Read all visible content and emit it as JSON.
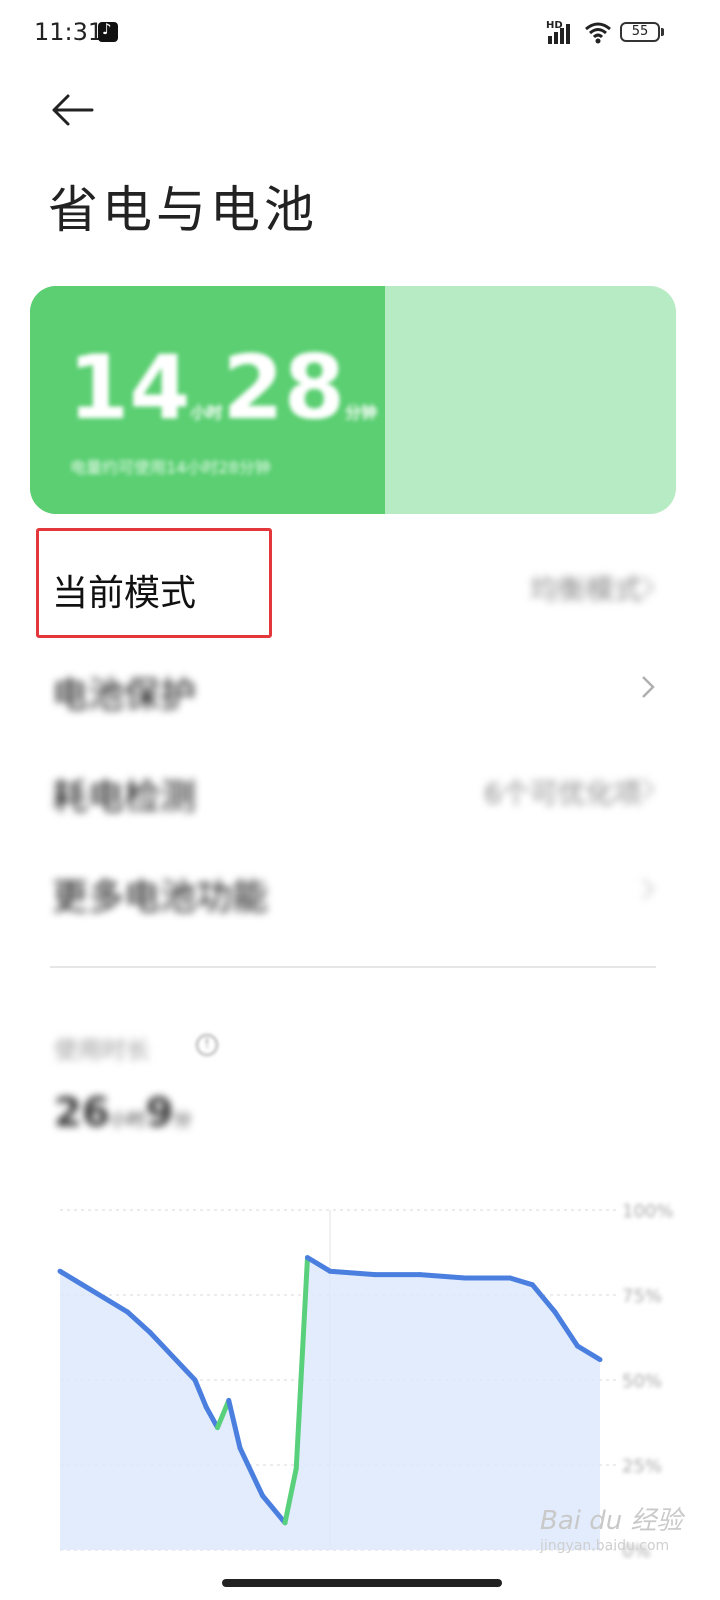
{
  "status_bar": {
    "time": "11:31",
    "network_label": "HD",
    "battery_level": "55"
  },
  "header": {
    "title": "省电与电池"
  },
  "battery_card": {
    "hours": "14",
    "hours_unit": "小时",
    "minutes": "28",
    "minutes_unit": "分钟",
    "subtitle": "电量约可使用14小时28分钟",
    "charge_fraction": 0.55,
    "colors": {
      "fill": "#5bcf72",
      "track": "#b6ebc4"
    }
  },
  "menu": {
    "items": [
      {
        "label": "当前模式",
        "value": "均衡模式"
      },
      {
        "label": "电池保护",
        "value": ""
      },
      {
        "label": "耗电检测",
        "value": "6个可优化项"
      },
      {
        "label": "更多电池功能",
        "value": ""
      }
    ]
  },
  "usage": {
    "label": "使用时长",
    "duration": "26小时9分",
    "hours": "26",
    "hours_unit": "小时",
    "minutes": "9",
    "minutes_unit": "分"
  },
  "chart_data": {
    "type": "line",
    "y_tick_labels": [
      "100%",
      "75%",
      "50%",
      "25%",
      "0%"
    ],
    "ylim": [
      0,
      100
    ],
    "x": [
      0,
      1,
      2,
      3,
      4,
      5,
      6,
      6.5,
      7,
      7.5,
      8,
      9,
      10,
      10.5,
      11,
      12,
      14,
      16,
      18,
      20,
      21,
      22,
      23,
      24
    ],
    "series": [
      {
        "values": [
          82,
          78,
          74,
          70,
          64,
          57,
          50,
          42,
          36,
          44,
          30,
          16,
          8,
          24,
          86,
          82,
          81,
          81,
          80,
          80,
          78,
          70,
          60,
          56
        ]
      }
    ],
    "colors": {
      "discharge": "#4a7fe0",
      "charge": "#59d07c",
      "area": "#dde9fc"
    },
    "grid": true
  },
  "watermark": {
    "text": "Bai du 经验",
    "sub": "jingyan.baidu.com"
  }
}
